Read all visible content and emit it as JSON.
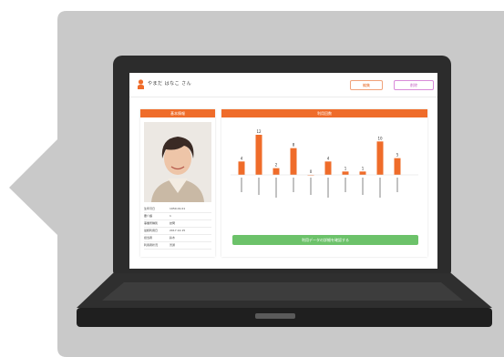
{
  "colors": {
    "accent": "#ef6c2a",
    "cta": "#6cc26a",
    "bubble": "#c9c9c9",
    "laptop": "#2c2c2c"
  },
  "header": {
    "user_name": "やまだ はなこ さん",
    "edit_label": "編集",
    "delete_label": "削除"
  },
  "profile": {
    "title": "基本情報",
    "rows": [
      {
        "k": "生年月日",
        "v": "1950.01.01"
      },
      {
        "k": "要介護",
        "v": "1"
      },
      {
        "k": "事業所種別",
        "v": "訪問"
      },
      {
        "k": "最終利用日",
        "v": "2017.12.15"
      },
      {
        "k": "担当者",
        "v": "鈴木"
      },
      {
        "k": "利用者状況",
        "v": "普通"
      }
    ]
  },
  "usage": {
    "title": "利用回数",
    "cta_label": "利用データの詳細を確認する"
  },
  "chart_data": {
    "type": "bar",
    "values": [
      4,
      12,
      2,
      8,
      0,
      4,
      1,
      1,
      10,
      5
    ]
  }
}
